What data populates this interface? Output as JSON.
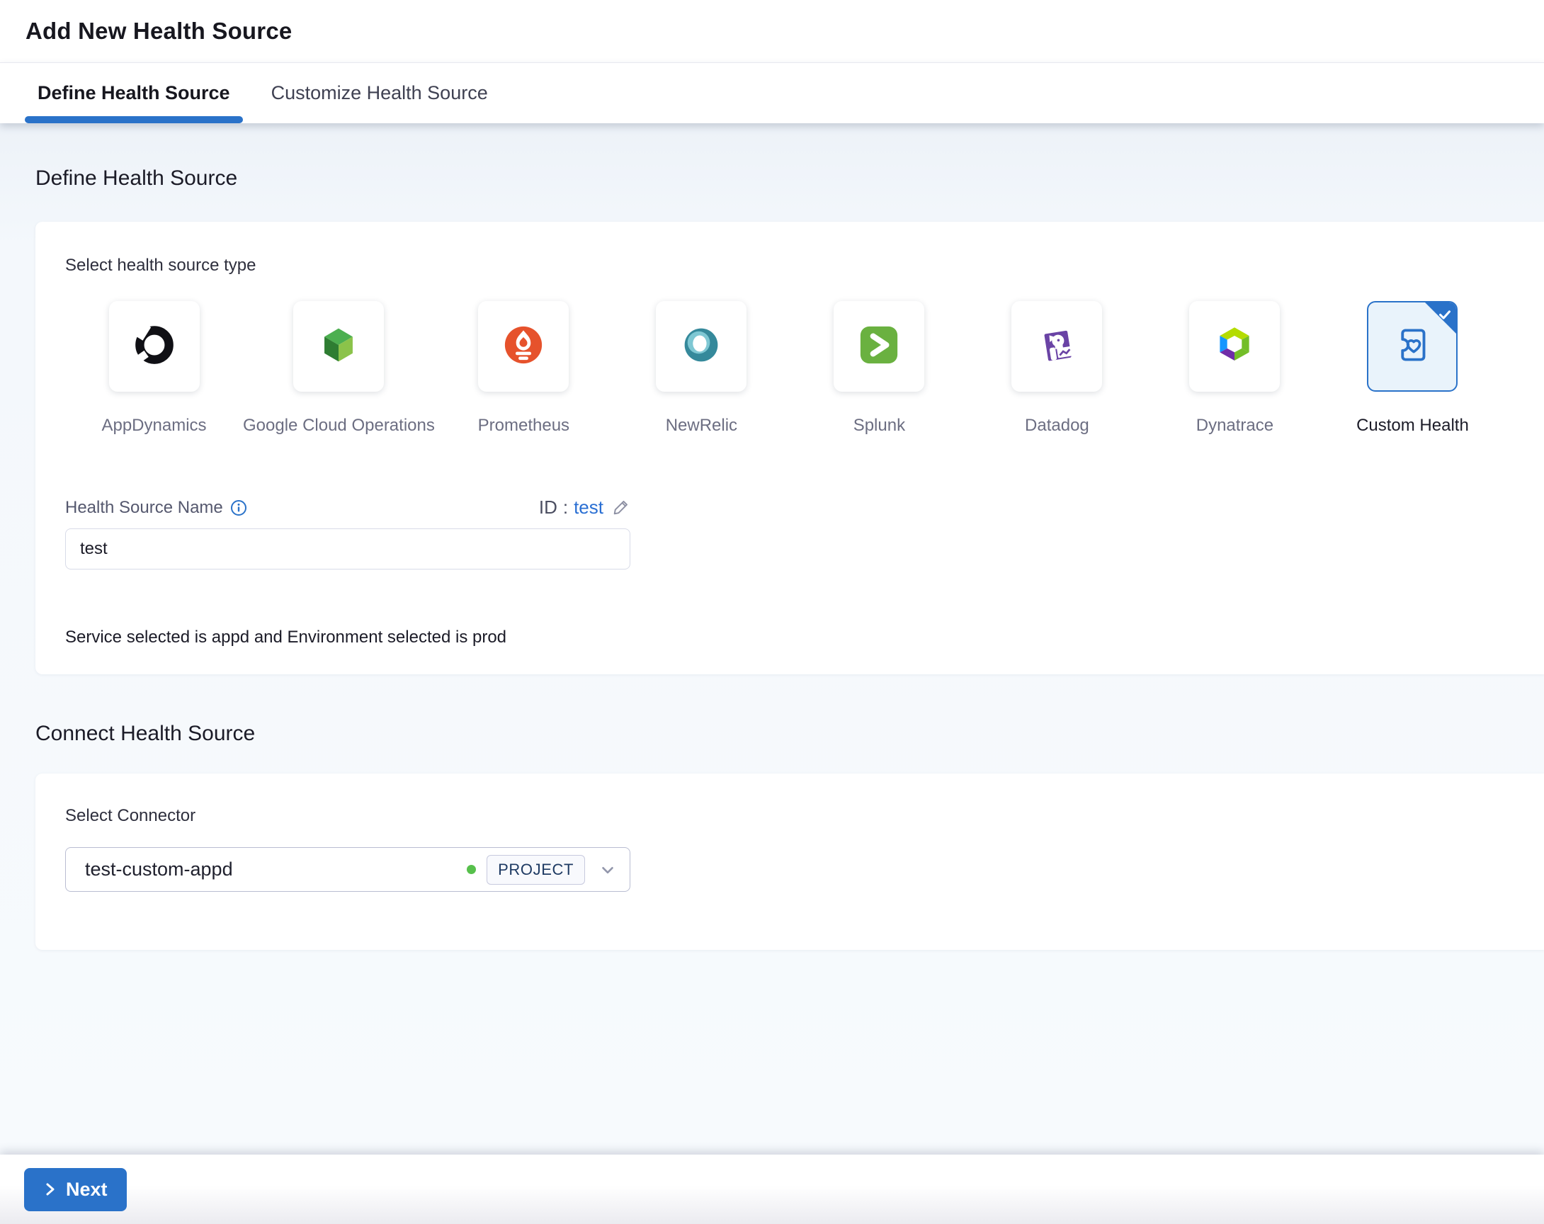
{
  "header": {
    "title": "Add New Health Source"
  },
  "tabs": [
    {
      "label": "Define Health Source",
      "active": true
    },
    {
      "label": "Customize Health Source",
      "active": false
    }
  ],
  "define_section": {
    "heading": "Define Health Source",
    "select_type_label": "Select health source type",
    "source_types": [
      {
        "name": "AppDynamics",
        "icon": "appdynamics-icon",
        "selected": false
      },
      {
        "name": "Google Cloud Operations",
        "icon": "google-cloud-operations-icon",
        "selected": false
      },
      {
        "name": "Prometheus",
        "icon": "prometheus-icon",
        "selected": false
      },
      {
        "name": "NewRelic",
        "icon": "newrelic-icon",
        "selected": false
      },
      {
        "name": "Splunk",
        "icon": "splunk-icon",
        "selected": false
      },
      {
        "name": "Datadog",
        "icon": "datadog-icon",
        "selected": false
      },
      {
        "name": "Dynatrace",
        "icon": "dynatrace-icon",
        "selected": false
      },
      {
        "name": "Custom Health",
        "icon": "custom-health-icon",
        "selected": true
      }
    ],
    "name_label": "Health Source Name",
    "id_label": "ID",
    "id_separator": ":",
    "id_value": "test",
    "name_value": "test",
    "service_env_note": "Service selected is appd and Environment selected is prod"
  },
  "connect_section": {
    "heading": "Connect Health Source",
    "select_connector_label": "Select Connector",
    "connector_value": "test-custom-appd",
    "connector_scope_badge": "PROJECT"
  },
  "footer": {
    "next_label": "Next"
  },
  "colors": {
    "accent": "#2a72c9",
    "status_green": "#57c04c",
    "selected_tile_bg": "#e9f3fb"
  }
}
